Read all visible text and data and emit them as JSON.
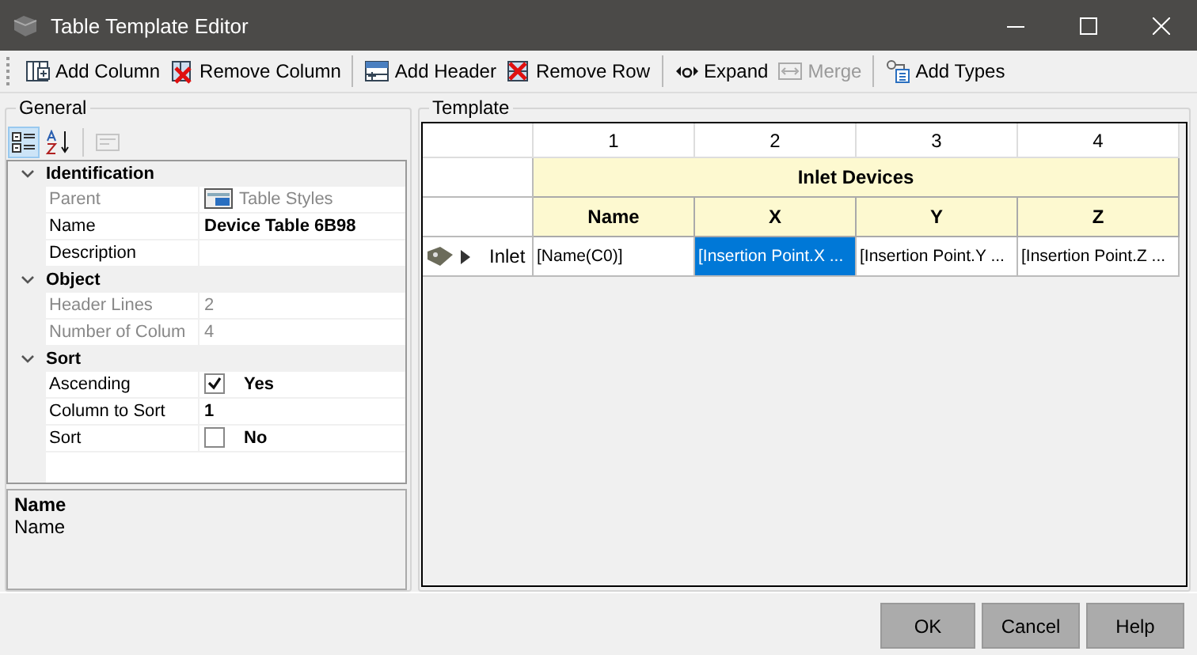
{
  "window": {
    "title": "Table Template Editor"
  },
  "toolbar": [
    [
      {
        "label": "Add Column",
        "disabled": false
      },
      {
        "label": "Remove Column",
        "disabled": false
      }
    ],
    [
      {
        "label": "Add Header",
        "disabled": false
      },
      {
        "label": "Remove Row",
        "disabled": false
      }
    ],
    [
      {
        "label": "Expand",
        "disabled": false
      },
      {
        "label": "Merge",
        "disabled": true
      }
    ],
    [
      {
        "label": "Add Types",
        "disabled": false
      }
    ]
  ],
  "general": {
    "title": "General",
    "grid_tools": [
      {
        "kind": "categorized",
        "selected": true
      },
      {
        "kind": "alphabetical",
        "selected": false
      },
      {
        "kind": "pages",
        "selected": false,
        "disabled": true
      }
    ],
    "categories": [
      {
        "name": "Identification",
        "expanded": true,
        "properties": [
          {
            "name": "Parent",
            "kind": "link",
            "value": "Table Styles",
            "readonly": true
          },
          {
            "name": "Name",
            "kind": "text",
            "value": "Device Table 6B98",
            "readonly": false
          },
          {
            "name": "Description",
            "kind": "text",
            "readonly": false
          }
        ]
      },
      {
        "name": "Object",
        "expanded": true,
        "properties": [
          {
            "name": "Header Lines",
            "kind": "text",
            "value": "2",
            "readonly": true
          },
          {
            "name": "Number of Colum",
            "kind": "text",
            "value": "4",
            "readonly": true
          }
        ]
      },
      {
        "name": "Sort",
        "expanded": true,
        "properties": [
          {
            "name": "Ascending",
            "kind": "checkbox",
            "checked": true,
            "value": "Yes",
            "readonly": false
          },
          {
            "name": "Column to Sort",
            "kind": "text",
            "value": "1",
            "readonly": false
          },
          {
            "name": "Sort",
            "kind": "checkbox",
            "checked": false,
            "value": "No",
            "readonly": false
          }
        ]
      }
    ],
    "help": {
      "title": "Name",
      "text": "Name"
    }
  },
  "template": {
    "title": "Template",
    "column_numbers": [
      "1",
      "2",
      "3",
      "4"
    ],
    "group_header": "Inlet Devices",
    "headers": [
      "Name",
      "X",
      "Y",
      "Z"
    ],
    "rows": [
      {
        "label": "Inlet",
        "cells": [
          {
            "text": "[Name(C0)]",
            "selected": false
          },
          {
            "text": "[Insertion Point.X ...",
            "selected": true
          },
          {
            "text": "[Insertion Point.Y ...",
            "selected": false
          },
          {
            "text": "[Insertion Point.Z ...",
            "selected": false
          }
        ]
      }
    ]
  },
  "buttons": [
    "OK",
    "Cancel",
    "Help"
  ]
}
